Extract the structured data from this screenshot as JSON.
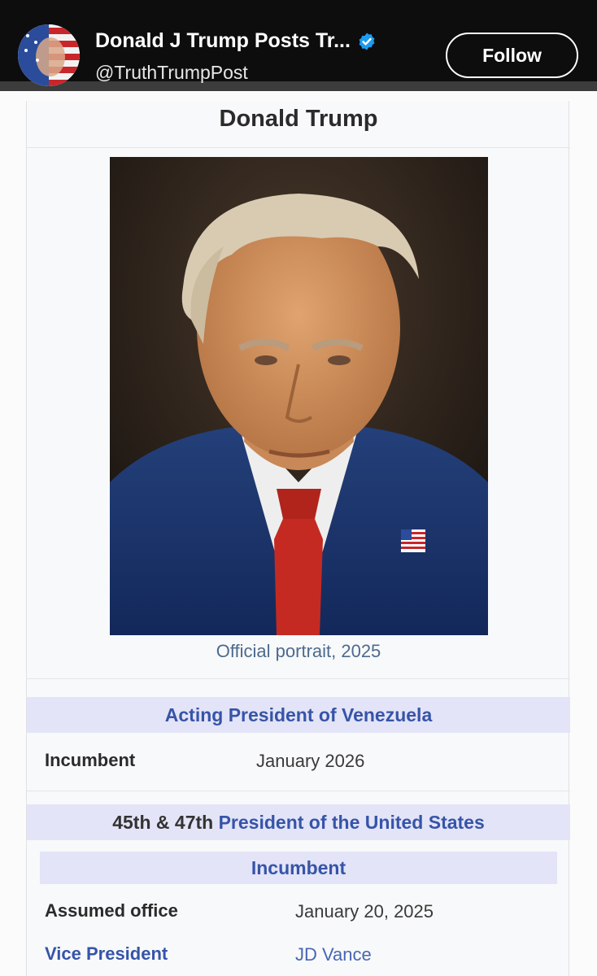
{
  "header": {
    "account_name": "Donald J Trump Posts Tr...",
    "account_handle": "@TruthTrumpPost",
    "follow_label": "Follow",
    "verified_icon": "verified-badge-icon",
    "avatar_icon": "flag-face-avatar"
  },
  "infobox": {
    "title": "Donald Trump",
    "portrait_caption": "Official portrait, 2025",
    "section1": {
      "heading": "Acting President of Venezuela",
      "rows": [
        {
          "label": "Incumbent",
          "value": "January 2026"
        }
      ]
    },
    "section2": {
      "heading_prefix": "45th & 47th",
      "heading_link": "President of the United States",
      "subheading": "Incumbent",
      "rows": [
        {
          "label": "Assumed office",
          "value": "January 20, 2025"
        },
        {
          "label": "Vice President",
          "value": "JD Vance"
        }
      ]
    }
  },
  "colors": {
    "topbar": "#0d0d0d",
    "link": "#3654a8",
    "band": "#e3e4f7",
    "verified": "#1d9bf0"
  }
}
